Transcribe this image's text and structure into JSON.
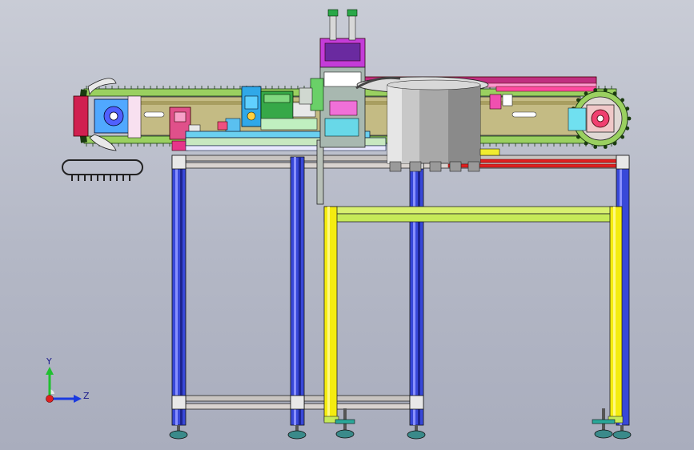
{
  "triad": {
    "y_label": "Y",
    "z_label": "Z"
  }
}
